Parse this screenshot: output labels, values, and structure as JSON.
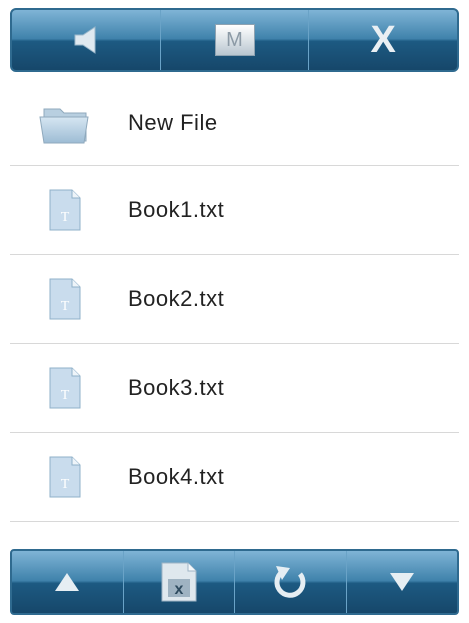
{
  "toolbar": {
    "icons": [
      "speaker-icon",
      "mode-icon",
      "close-icon"
    ],
    "mode_label": "M",
    "close_label": "X"
  },
  "files": [
    {
      "name": "New File",
      "icon": "folder-icon"
    },
    {
      "name": "Book1.txt",
      "icon": "text-file-icon"
    },
    {
      "name": "Book2.txt",
      "icon": "text-file-icon"
    },
    {
      "name": "Book3.txt",
      "icon": "text-file-icon"
    },
    {
      "name": "Book4.txt",
      "icon": "text-file-icon"
    }
  ],
  "bottombar": {
    "icons": [
      "arrow-up-icon",
      "delete-file-icon",
      "refresh-icon",
      "arrow-down-icon"
    ]
  }
}
